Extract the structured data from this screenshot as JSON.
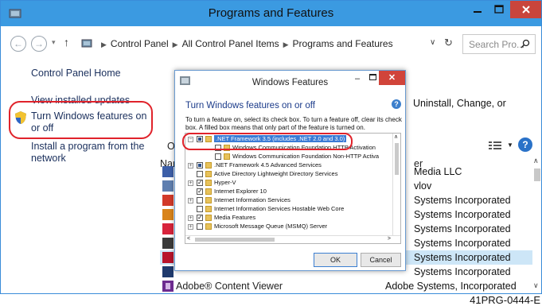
{
  "window": {
    "title": "Programs and Features"
  },
  "address": {
    "crumbs": [
      "Control Panel",
      "All Control Panel Items",
      "Programs and Features"
    ],
    "search_placeholder": "Search Pro..."
  },
  "left_pane": {
    "home": "Control Panel Home",
    "updates": "View installed updates",
    "features": "Turn Windows features on or off",
    "install": "Install a program from the network"
  },
  "main": {
    "description_fragment": "Uninstall, Change, or",
    "organize": "O",
    "col_name": "Nar",
    "col_publisher": "er",
    "rows": [
      {
        "publisher": "Media LLC",
        "icon_color": "#3d5fa8",
        "selected": false
      },
      {
        "publisher": "vlov",
        "icon_color": "#5f7fb0",
        "selected": false
      },
      {
        "publisher": "Systems Incorporated",
        "icon_color": "#d23a2a",
        "selected": false
      },
      {
        "publisher": "Systems Incorporated",
        "icon_color": "#d9841b",
        "selected": false
      },
      {
        "publisher": "Systems Incorporated",
        "icon_color": "#d8243c",
        "selected": false
      },
      {
        "publisher": "Systems Incorporated",
        "icon_color": "#3b3b3b",
        "selected": false
      },
      {
        "publisher": "Systems Incorporated",
        "icon_color": "#b8142b",
        "selected": true
      },
      {
        "publisher": "Systems Incorporated",
        "icon_color": "#1f3a6d",
        "selected": false
      }
    ],
    "last_row": {
      "name": "Adobe® Content Viewer",
      "publisher": "Adobe Systems, Incorporated"
    }
  },
  "dialog": {
    "title": "Windows Features",
    "heading": "Turn Windows features on or off",
    "description": "To turn a feature on, select its check box. To turn a feature off, clear its check box. A filled box means that only part of the feature is turned on.",
    "tree": [
      {
        "label": ".NET Framework 3.5 (includes .NET 2.0 and 3.0)",
        "level": 0,
        "expand": "minus",
        "check": "partial",
        "selected": true
      },
      {
        "label": "Windows Communication Foundation HTTP Activation",
        "level": 1,
        "expand": "",
        "check": "none",
        "selected": false
      },
      {
        "label": "Windows Communication Foundation Non-HTTP Activa",
        "level": 1,
        "expand": "",
        "check": "none",
        "selected": false
      },
      {
        "label": ".NET Framework 4.5 Advanced Services",
        "level": 0,
        "expand": "plus",
        "check": "partial",
        "selected": false
      },
      {
        "label": "Active Directory Lightweight Directory Services",
        "level": 0,
        "expand": "",
        "check": "none",
        "selected": false
      },
      {
        "label": "Hyper-V",
        "level": 0,
        "expand": "plus",
        "check": "checked",
        "selected": false
      },
      {
        "label": "Internet Explorer 10",
        "level": 0,
        "expand": "",
        "check": "checked",
        "selected": false
      },
      {
        "label": "Internet Information Services",
        "level": 0,
        "expand": "plus",
        "check": "none",
        "selected": false
      },
      {
        "label": "Internet Information Services Hostable Web Core",
        "level": 0,
        "expand": "",
        "check": "none",
        "selected": false
      },
      {
        "label": "Media Features",
        "level": 0,
        "expand": "plus",
        "check": "checked",
        "selected": false
      },
      {
        "label": "Microsoft Message Queue (MSMQ) Server",
        "level": 0,
        "expand": "plus",
        "check": "none",
        "selected": false
      }
    ],
    "ok": "OK",
    "cancel": "Cancel"
  },
  "caption": "41PRG-0444-E",
  "colors": {
    "titlebar": "#3b9ae1",
    "callout": "#e0232b",
    "selection": "#cde6f7",
    "link": "#1a2f5c"
  }
}
